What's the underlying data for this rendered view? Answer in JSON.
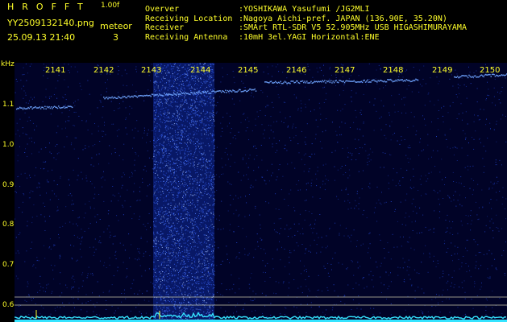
{
  "header": {
    "brand": "HROFFT",
    "version": "1.00f",
    "filename": "YY2509132140.png",
    "meteor_label": "meteor",
    "datetime": "25.09.13 21:40",
    "meteor_count": "3",
    "info": [
      {
        "key": "Overver",
        "value": ":YOSHIKAWA Yasufumi /JG2MLI"
      },
      {
        "key": "Receiving Location",
        "value": ":Nagoya Aichi-pref. JAPAN (136.90E, 35.20N)"
      },
      {
        "key": "Receiver",
        "value": ":SMArt RTL-SDR V5 52.905MHz USB HIGASHIMURAYAMA"
      },
      {
        "key": "Receiving Antenna",
        "value": ":10mH 3el.YAGI Horizontal:ENE"
      }
    ]
  },
  "y_axis": {
    "unit": "kHz",
    "ticks": [
      "1.1",
      "1.0",
      "0.9",
      "0.8",
      "0.7",
      "0.6"
    ]
  },
  "x_axis": {
    "ticks": [
      "2141",
      "2142",
      "2143",
      "2144",
      "2145",
      "2146",
      "2147",
      "2148",
      "2149",
      "2150"
    ]
  },
  "colors": {
    "text": "#ffff2a",
    "background": "#010327",
    "signal": "#4a8cff",
    "noise_floor": "#35e4ff"
  }
}
